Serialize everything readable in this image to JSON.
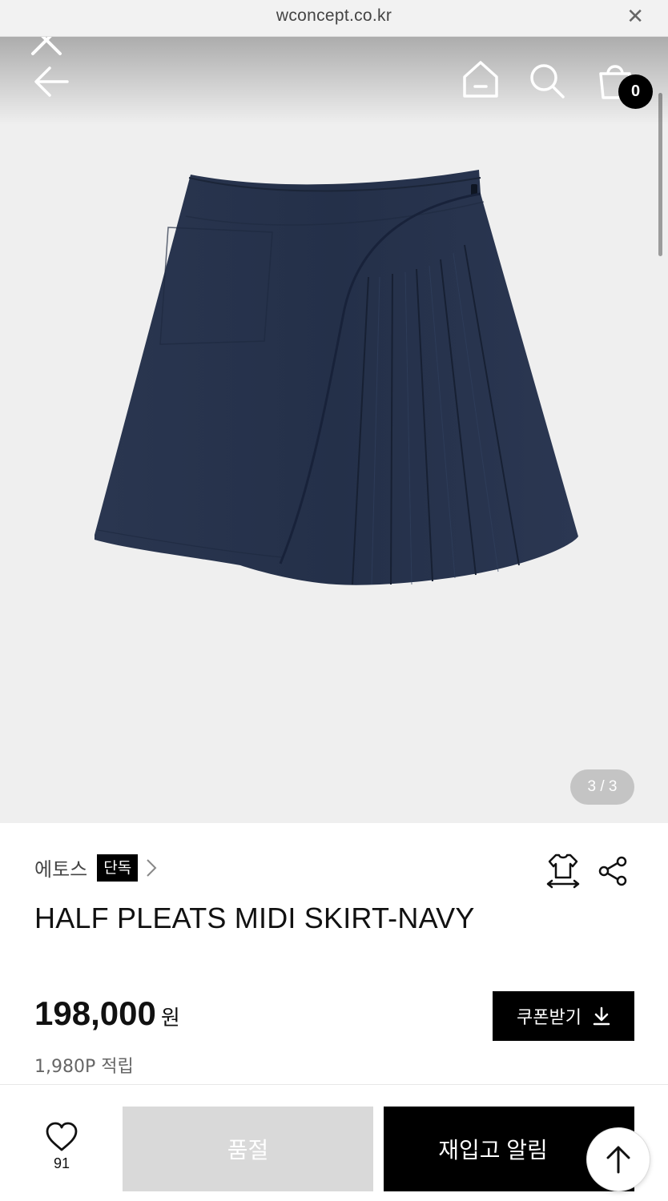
{
  "browser": {
    "url": "wconcept.co.kr",
    "close_icon": "close-icon"
  },
  "header": {
    "cart_count": "0",
    "icons": [
      "close-icon",
      "back-arrow-icon",
      "home-icon",
      "search-icon",
      "shopping-bag-icon"
    ]
  },
  "gallery": {
    "counter": "3 / 3",
    "image": "navy-pleated-skirt"
  },
  "product": {
    "brand": "에토스",
    "brand_tag": "단독",
    "title": "HALF PLEATS MIDI SKIRT-NAVY",
    "price": "198,000",
    "currency": "원",
    "points": "1,980P 적립",
    "coupon_label": "쿠폰받기"
  },
  "actions": {
    "like_count": "91",
    "soldout_label": "품절",
    "restock_label": "재입고 알림"
  },
  "colors": {
    "skirt": "#27334a",
    "gallery_bg": "#efefef",
    "soldout_bg": "#d9d9d9",
    "primary": "#000000"
  }
}
